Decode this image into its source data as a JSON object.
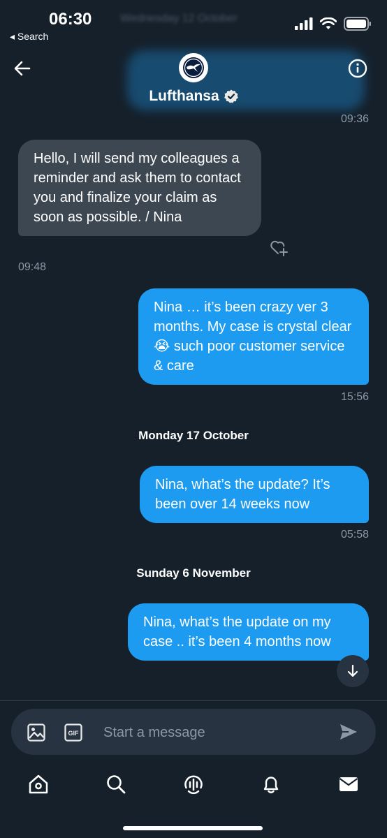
{
  "status_bar": {
    "time": "06:30",
    "back_label": "◂ Search"
  },
  "background_ghost": {
    "date": "Wednesday 12 October"
  },
  "header": {
    "contact_name": "Lufthansa"
  },
  "messages": [
    {
      "direction": "outgoing",
      "timestamp": "09:36"
    },
    {
      "direction": "incoming",
      "text": "Hello, I will send my colleagues a reminder and ask them to contact you and finalize your claim as soon as possible. / Nina",
      "timestamp": "09:48"
    },
    {
      "direction": "outgoing",
      "text": "Nina … it’s been crazy ver 3 months. My case is crystal clear 😭 such poor customer service & care",
      "timestamp": "15:56"
    },
    {
      "day_separator": "Monday 17 October"
    },
    {
      "direction": "outgoing",
      "text": "Nina, what’s the update? It’s been over 14 weeks now",
      "timestamp": "05:58"
    },
    {
      "day_separator": "Sunday 6 November"
    },
    {
      "direction": "outgoing",
      "text": "Nina, what’s the update on my case .. it’s been 4 months now"
    }
  ],
  "composer": {
    "placeholder": "Start a message",
    "gif_label": "GIF"
  },
  "nav": [
    "home-icon",
    "search-icon",
    "spaces-icon",
    "notifications-icon",
    "messages-icon"
  ],
  "colors": {
    "background": "#15202b",
    "outgoing_bubble": "#1d9bf0",
    "incoming_bubble": "#3d4751",
    "muted_text": "#8b98a5"
  }
}
